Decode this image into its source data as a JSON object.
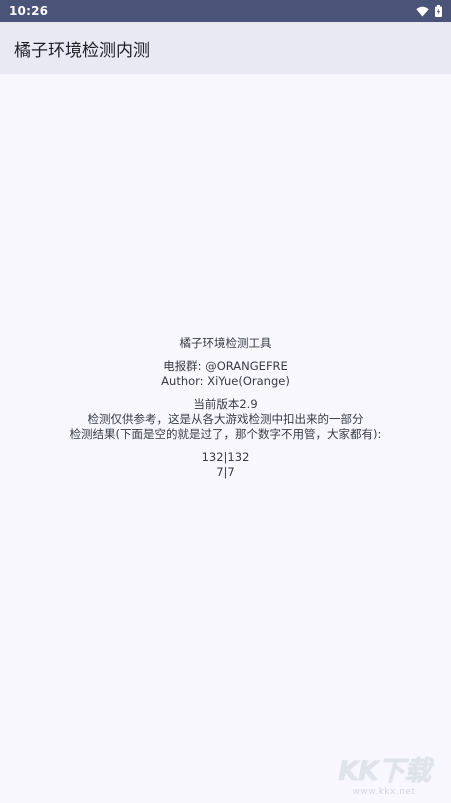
{
  "status_bar": {
    "time": "10:26",
    "icons": [
      "wifi-icon",
      "battery-icon"
    ]
  },
  "app_bar": {
    "title": "橘子环境检测内测"
  },
  "info": {
    "tool_name": "橘子环境检测工具",
    "telegram_group": "电报群: @ORANGEFRE",
    "author": "Author: XiYue(Orange)",
    "version": "当前版本2.9",
    "disclaimer": "检测仅供参考，这是从各大游戏检测中扣出来的一部分",
    "result_note": "检测结果(下面是空的就是过了，那个数字不用管，大家都有):",
    "count_a": "132|132",
    "count_b": "7|7"
  },
  "watermark": {
    "logo": "KK下载",
    "url": "www.kkx.net"
  },
  "colors": {
    "status_bar": "#4a5478",
    "app_bar": "#e8e9f3",
    "background": "#f7f7fd"
  }
}
